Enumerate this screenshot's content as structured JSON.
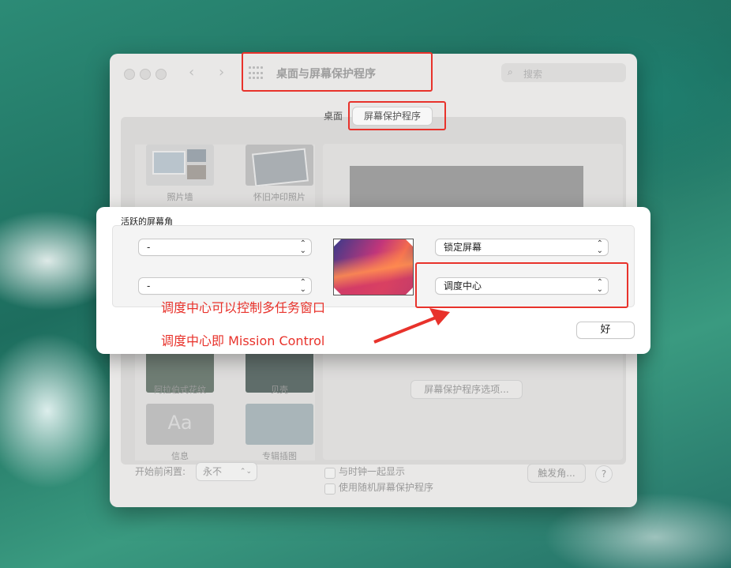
{
  "window": {
    "title": "桌面与屏幕保护程序",
    "search_placeholder": "搜索",
    "tabs": [
      "桌面",
      "屏幕保护程序"
    ],
    "screensavers": [
      "照片墙",
      "怀旧冲印照片",
      "阿拉伯式花纹",
      "贝壳",
      "信息",
      "专辑插图"
    ],
    "info_thumb_text": "Aa",
    "options_button": "屏幕保护程序选项...",
    "idle_label": "开始前闲置:",
    "idle_value": "永不",
    "checkbox_clock": "与时钟一起显示",
    "checkbox_random": "使用随机屏幕保护程序",
    "hot_corners_button": "触发角...",
    "help": "?"
  },
  "sheet": {
    "title": "活跃的屏幕角",
    "top_left": "-",
    "bottom_left": "-",
    "top_right": "锁定屏幕",
    "bottom_right": "调度中心",
    "ok": "好"
  },
  "annotations": {
    "line1": "调度中心可以控制多任务窗口",
    "line2": "调度中心即 Mission Control",
    "color": "#e8322b"
  }
}
